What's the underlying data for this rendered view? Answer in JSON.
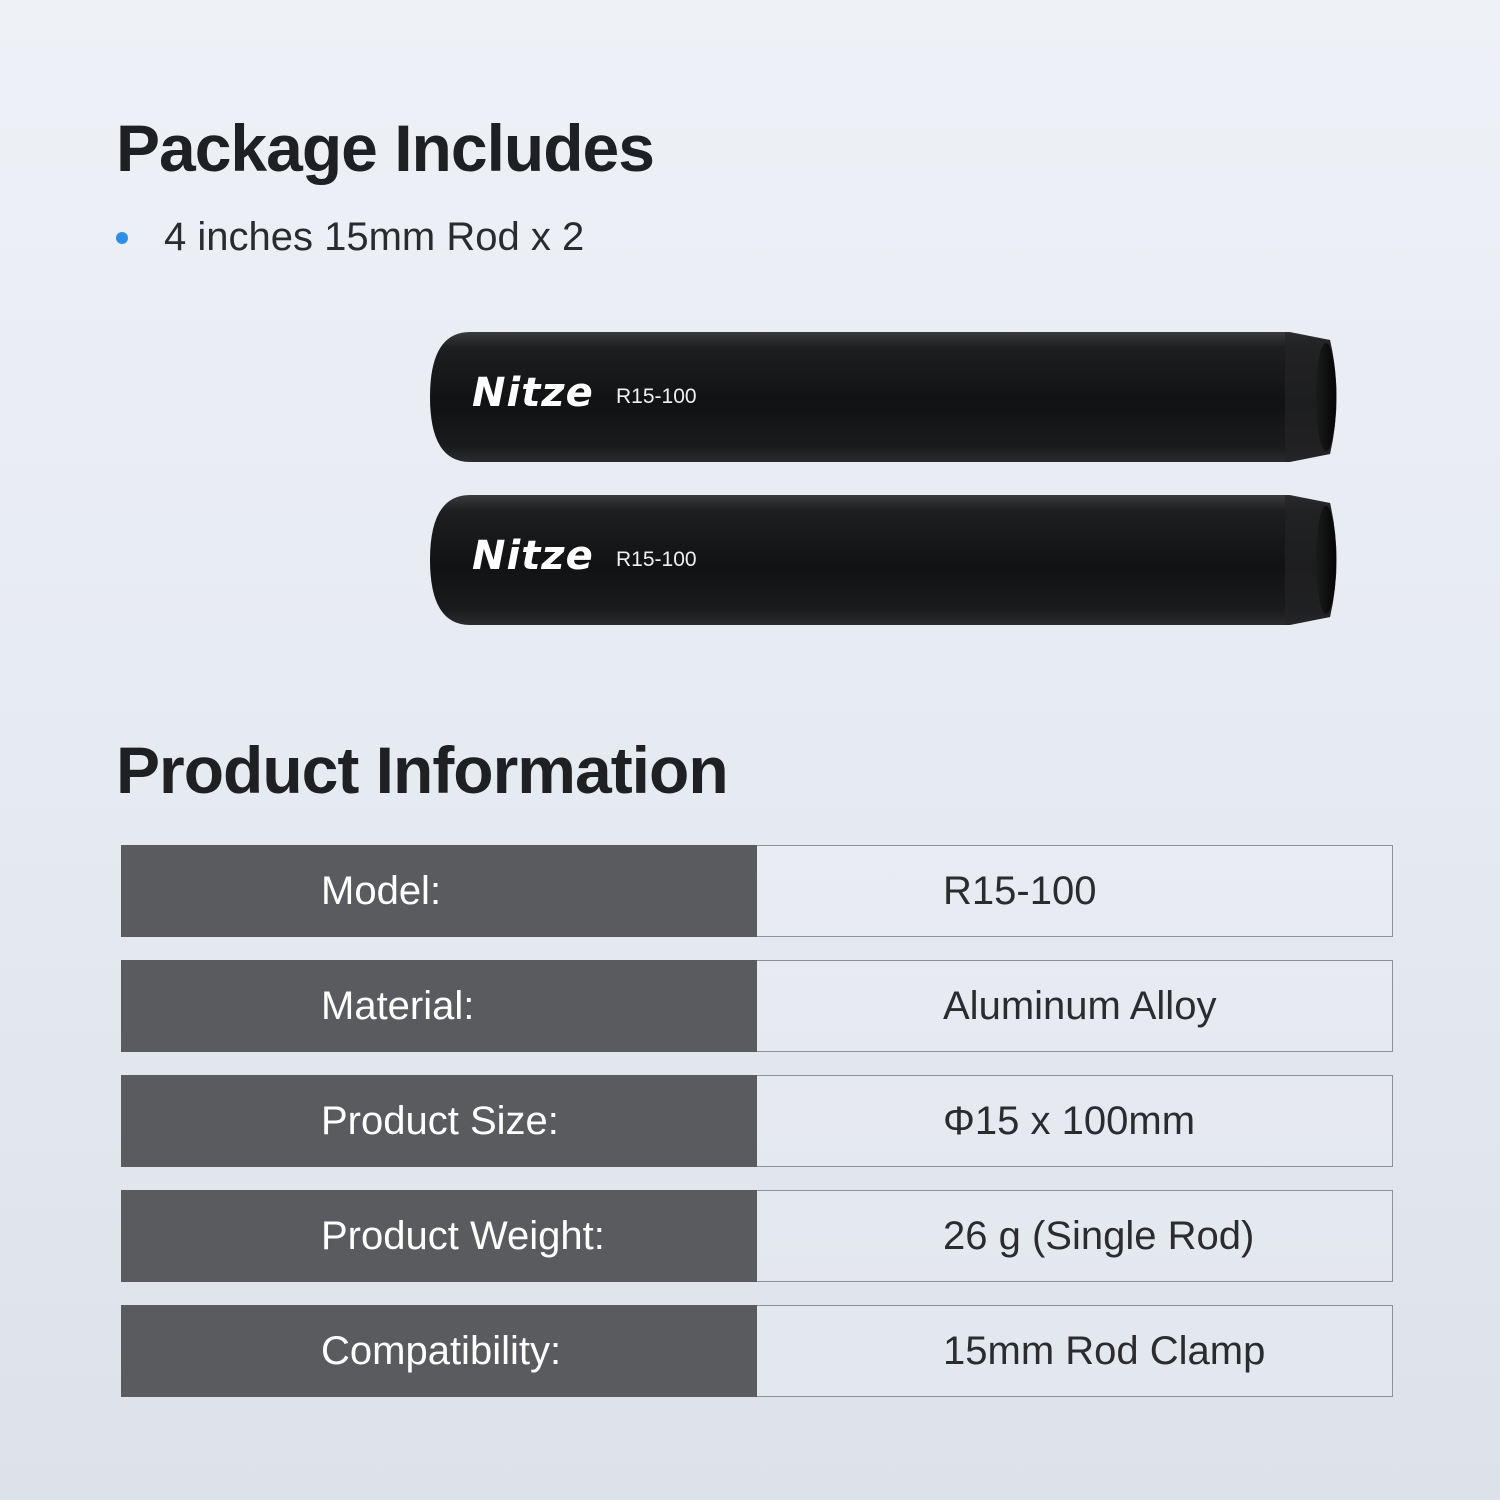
{
  "package": {
    "title": "Package Includes",
    "items": [
      "4 inches 15mm Rod x 2"
    ]
  },
  "rods": [
    {
      "brand": "Nitze",
      "model": "R15-100"
    },
    {
      "brand": "Nitze",
      "model": "R15-100"
    }
  ],
  "info": {
    "title": "Product Information",
    "rows": [
      {
        "label": "Model:",
        "value": "R15-100"
      },
      {
        "label": "Material:",
        "value": "Aluminum Alloy"
      },
      {
        "label": "Product Size:",
        "value": "Φ15 x 100mm"
      },
      {
        "label": "Product Weight:",
        "value": "26 g (Single Rod)"
      },
      {
        "label": "Compatibility:",
        "value": "15mm Rod Clamp"
      }
    ]
  },
  "colors": {
    "bullet": "#2f8ee8",
    "label_bg": "#5a5b5e",
    "rod": "#161718"
  }
}
